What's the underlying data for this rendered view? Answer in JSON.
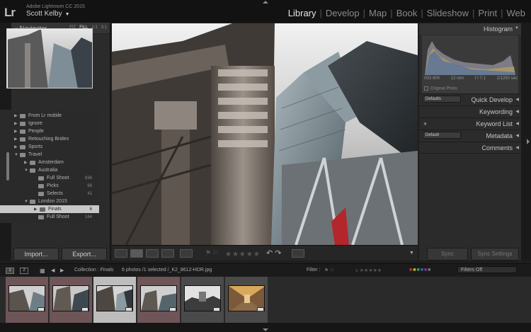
{
  "app": {
    "logo": "Lr",
    "product": "Adobe Lightroom CC 2015",
    "user": "Scott Kelby"
  },
  "modules": [
    {
      "label": "Library",
      "active": true
    },
    {
      "label": "Develop",
      "active": false
    },
    {
      "label": "Map",
      "active": false
    },
    {
      "label": "Book",
      "active": false
    },
    {
      "label": "Slideshow",
      "active": false
    },
    {
      "label": "Print",
      "active": false
    },
    {
      "label": "Web",
      "active": false
    }
  ],
  "navigator": {
    "title": "Navigator",
    "zoom": [
      "FIT",
      "FILL",
      "1:1",
      "3:1"
    ],
    "zoom_selected": "FILL"
  },
  "folders": [
    {
      "label": "From Lr mobile",
      "count": ""
    },
    {
      "label": "Ignore",
      "count": ""
    },
    {
      "label": "People",
      "count": ""
    },
    {
      "label": "Retouching Brides",
      "count": ""
    },
    {
      "label": "Sports",
      "count": ""
    },
    {
      "label": "Travel",
      "count": ""
    },
    {
      "label": "Amsterdam",
      "count": ""
    },
    {
      "label": "Australia",
      "count": ""
    },
    {
      "label": "Full Shoot",
      "count": "836"
    },
    {
      "label": "Picks",
      "count": "68"
    },
    {
      "label": "Selects",
      "count": "41"
    },
    {
      "label": "London 2015",
      "count": ""
    },
    {
      "label": "Finals",
      "count": "6"
    },
    {
      "label": "Full Shoot",
      "count": "164"
    }
  ],
  "left_buttons": {
    "import": "Import...",
    "export": "Export..."
  },
  "right_panel": {
    "histogram": "Histogram",
    "iso": "ISO 800",
    "focal": "12 mm",
    "aperture": "f / 7.1",
    "shutter": "1/1250 sec",
    "original_photo": "Original Photo",
    "quick_develop": "Quick Develop",
    "quick_develop_preset": "Defaults",
    "keywording": "Keywording",
    "keyword_list": "Keyword List",
    "keyword_plus": "+",
    "metadata": "Metadata",
    "metadata_preset": "Default",
    "comments": "Comments",
    "sync": "Sync",
    "sync_settings": "Sync Settings"
  },
  "filmbar": {
    "page1": "1",
    "page2": "2",
    "collection": "Collection : Finals",
    "count": "6 photos /1 selected /_K2_8612-HDR.jpg",
    "filter_label": "Filter :",
    "filters_off": "Filters Off"
  },
  "colors": {
    "thumb_selected": "#bdbdbd",
    "thumb_red_label": "#6e5558",
    "thumb_gray": "#4a4a4a"
  }
}
